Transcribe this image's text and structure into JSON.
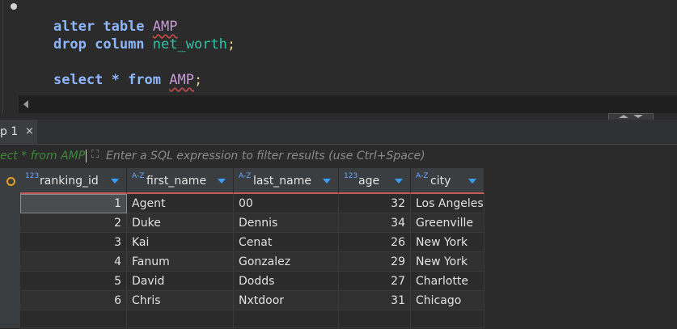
{
  "editor": {
    "lines": [
      {
        "kw": "alter table",
        "rest": "AMP",
        "punct": ""
      },
      {
        "kw": "drop column",
        "rest": "net_worth",
        "punct": ";"
      },
      {
        "kw": "select * from",
        "rest": "AMP",
        "punct": ";"
      }
    ]
  },
  "results_tab": {
    "label": "p 1",
    "close": "×"
  },
  "filter": {
    "query_text": "ect * from AMP",
    "placeholder": "Enter a SQL expression to filter results (use Ctrl+Space)"
  },
  "table": {
    "columns": [
      {
        "type": "123",
        "name": "ranking_id"
      },
      {
        "type": "A-Z",
        "name": "first_name"
      },
      {
        "type": "A-Z",
        "name": "last_name"
      },
      {
        "type": "123",
        "name": "age"
      },
      {
        "type": "A-Z",
        "name": "city"
      }
    ],
    "rows": [
      [
        "1",
        "Agent",
        "00",
        "32",
        "Los Angeles"
      ],
      [
        "2",
        "Duke",
        "Dennis",
        "34",
        "Greenville"
      ],
      [
        "3",
        "Kai",
        "Cenat",
        "26",
        "New York"
      ],
      [
        "4",
        "Fanum",
        "Gonzalez",
        "29",
        "New York"
      ],
      [
        "5",
        "David",
        "Dodds",
        "27",
        "Charlotte"
      ],
      [
        "6",
        "Chris",
        "Nxtdoor",
        "31",
        "Chicago"
      ]
    ]
  },
  "colors": {
    "accent": "#3aa0ff",
    "header_underline": "#c55a5a"
  }
}
